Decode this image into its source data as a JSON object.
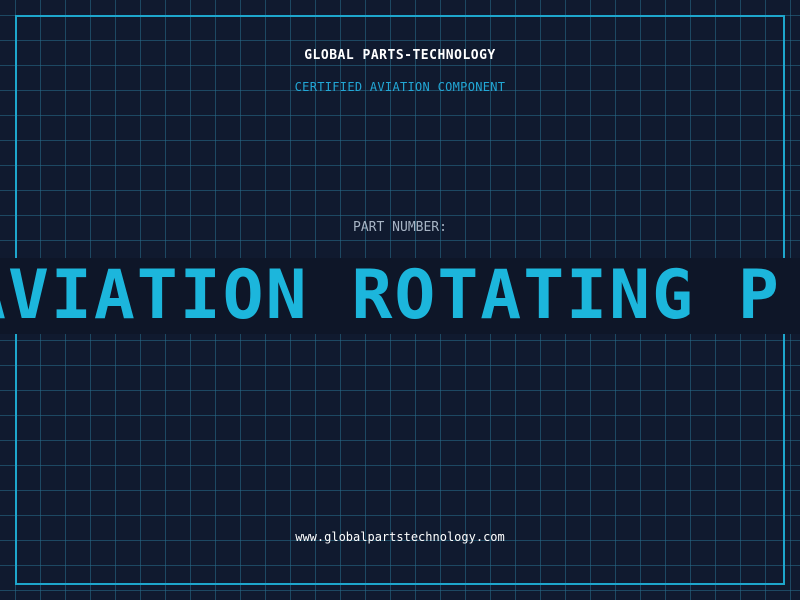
{
  "header": {
    "company_name": "GLOBAL PARTS-TECHNOLOGY",
    "subtitle": "CERTIFIED AVIATION COMPONENT"
  },
  "part": {
    "label": "PART NUMBER:",
    "value": "AVIATION ROTATING P"
  },
  "footer": {
    "website": "www.globalpartstechnology.com"
  },
  "colors": {
    "background": "#101a2f",
    "grid": "#286e8c",
    "accent": "#1cb6dc",
    "frame": "#1ea6cc"
  }
}
